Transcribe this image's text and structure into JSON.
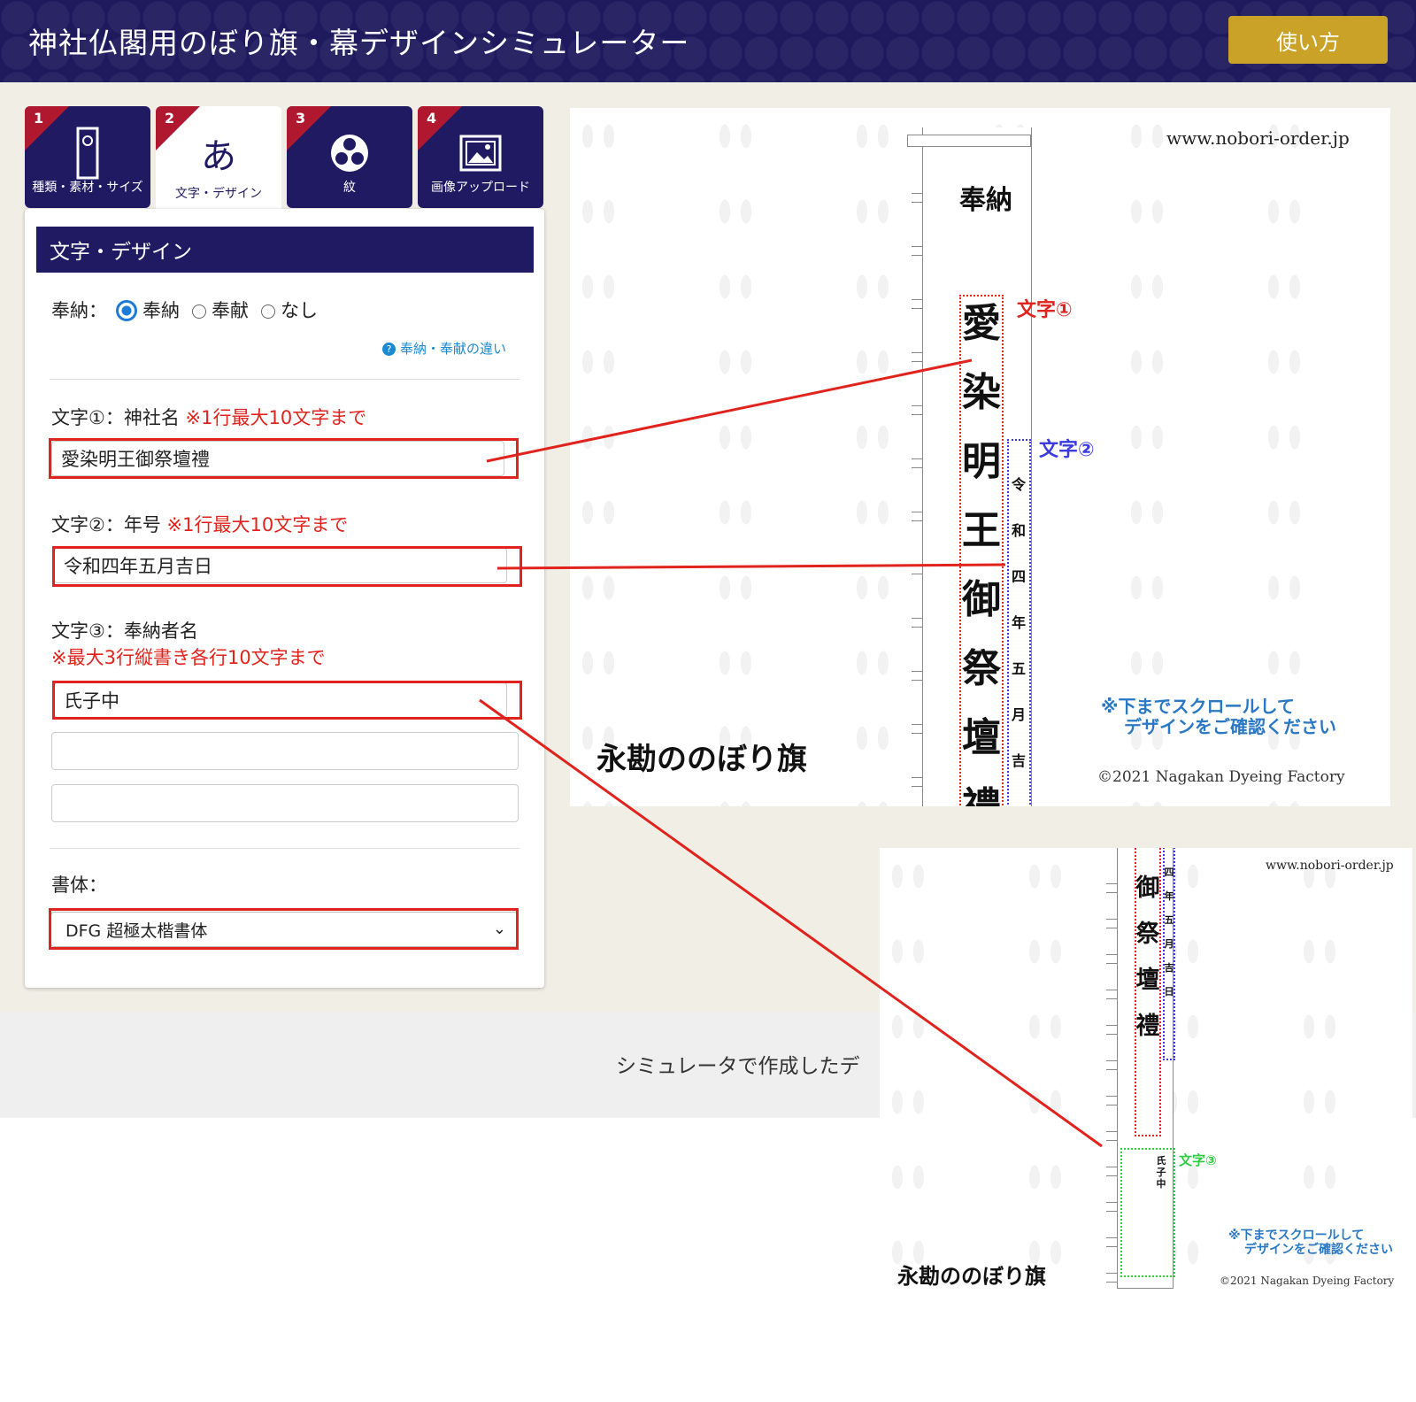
{
  "header": {
    "title": "神社仏閣用のぼり旗・幕デザインシミュレーター",
    "help_label": "使い方"
  },
  "tabs": [
    {
      "num": "1",
      "label": "種類・素材・サイズ",
      "icon": "banner-icon"
    },
    {
      "num": "2",
      "label": "文字・デザイン",
      "icon_char": "あ",
      "active": true
    },
    {
      "num": "3",
      "label": "紋",
      "icon": "tomoe-crest-icon"
    },
    {
      "num": "4",
      "label": "画像アップロード",
      "icon": "image-icon"
    }
  ],
  "panel": {
    "title": "文字・デザイン",
    "hono": {
      "label": "奉納：",
      "options": [
        "奉納",
        "奉献",
        "なし"
      ],
      "selected": "奉納",
      "diff_link": "奉納・奉献の違い",
      "help_glyph": "?"
    },
    "text1": {
      "label": "文字①：神社名",
      "note": "※1行最大10文字まで",
      "value": "愛染明王御祭壇禮"
    },
    "text2": {
      "label": "文字②：年号",
      "note": "※1行最大10文字まで",
      "value": "令和四年五月吉日"
    },
    "text3": {
      "label": "文字③：奉納者名",
      "note": "※最大3行縦書き各行10文字まで",
      "values": [
        "氏子中",
        "",
        ""
      ]
    },
    "font": {
      "label": "書体：",
      "selected": "DFG 超極太楷書体"
    }
  },
  "preview_top": {
    "url": "www.nobori-order.jp",
    "hono_text": "奉納",
    "main_chars": [
      "愛",
      "染",
      "明",
      "王",
      "御",
      "祭",
      "壇",
      "禮"
    ],
    "date_chars": [
      "令",
      "和",
      "四",
      "年",
      "五",
      "月",
      "吉"
    ],
    "label1": "文字①",
    "label2": "文字②",
    "scroll_note_1": "※下までスクロールして",
    "scroll_note_2": "デザインをご確認ください",
    "brand": "永勘ののぼり旗",
    "copyright": "©2021 Nagakan Dyeing Factory"
  },
  "preview_bottom": {
    "url": "www.nobori-order.jp",
    "main_chars": [
      "御",
      "祭",
      "壇",
      "禮"
    ],
    "date_chars": [
      "四",
      "年",
      "五",
      "月",
      "吉",
      "日"
    ],
    "donor_chars": [
      "氏",
      "子",
      "中"
    ],
    "label3": "文字③",
    "scroll_note_1": "※下までスクロールして",
    "scroll_note_2": "デザインをご確認ください",
    "brand": "永勘ののぼり旗",
    "copyright": "©2021 Nagakan Dyeing Factory"
  },
  "footer": {
    "text": "シミュレータで作成したデ"
  },
  "colors": {
    "navy": "#201a63",
    "gold": "#c9a227",
    "red_marker": "#e0231c",
    "accent_blue": "#1b7bd6"
  }
}
